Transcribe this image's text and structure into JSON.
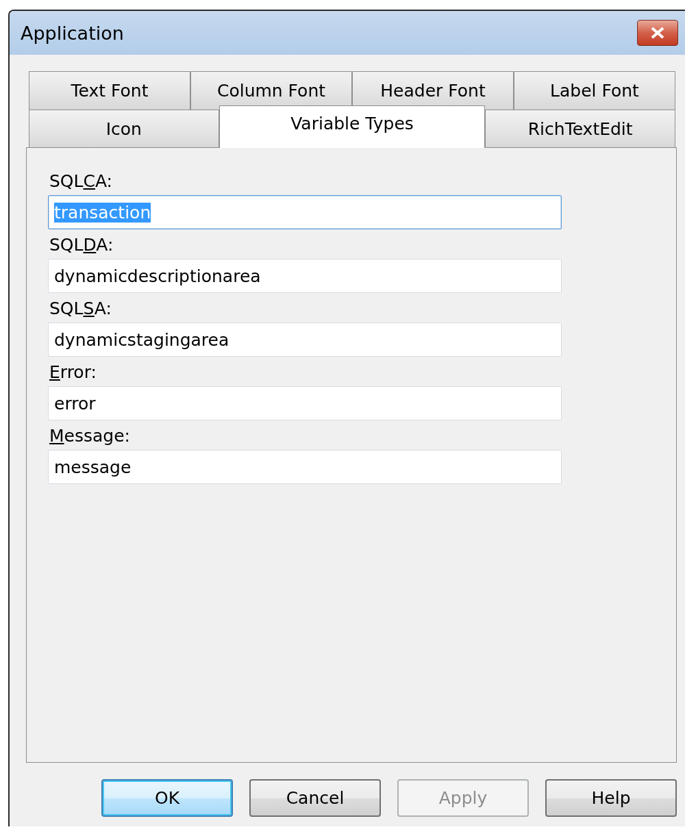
{
  "window": {
    "title": "Application"
  },
  "tab_rows": [
    {
      "tabs": [
        {
          "label": "Text Font",
          "selected": false
        },
        {
          "label": "Column Font",
          "selected": false
        },
        {
          "label": "Header Font",
          "selected": false
        },
        {
          "label": "Label Font",
          "selected": false
        }
      ]
    },
    {
      "tabs": [
        {
          "label": "Icon",
          "selected": false
        },
        {
          "label": "Variable Types",
          "selected": true
        },
        {
          "label": "RichTextEdit",
          "selected": false
        }
      ]
    }
  ],
  "fields": [
    {
      "label_before": "SQL",
      "access_key": "C",
      "label_after": "A:",
      "value": "transaction",
      "focused": true
    },
    {
      "label_before": "SQL",
      "access_key": "D",
      "label_after": "A:",
      "value": "dynamicdescriptionarea",
      "focused": false
    },
    {
      "label_before": "SQL",
      "access_key": "S",
      "label_after": "A:",
      "value": "dynamicstagingarea",
      "focused": false
    },
    {
      "access_key": "E",
      "label_after": "rror:",
      "value": "error",
      "focused": false
    },
    {
      "access_key": "M",
      "label_after": "essage:",
      "value": "message",
      "focused": false
    }
  ],
  "buttons": [
    {
      "label": "OK",
      "default": true,
      "disabled": false
    },
    {
      "label": "Cancel",
      "default": false,
      "disabled": false
    },
    {
      "label": "Apply",
      "default": false,
      "disabled": true
    },
    {
      "label": "Help",
      "default": false,
      "disabled": false
    }
  ]
}
